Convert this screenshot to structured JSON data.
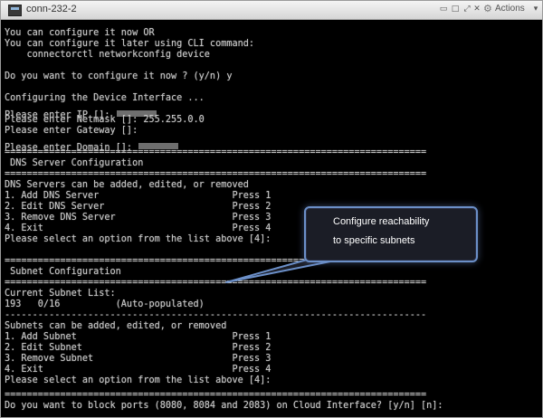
{
  "window": {
    "title": "conn-232-2",
    "actions_label": "Actions"
  },
  "terminal": {
    "lines": [
      "You can configure it now OR",
      "You can configure it later using CLI command:",
      "    connectorctl networkconfig device",
      "",
      "Do you want to configure it now ? (y/n) y",
      "",
      "Configuring the Device Interface ...",
      "Please enter IP []:",
      "Please enter Netmask []: 255.255.0.0",
      "Please enter Gateway []:",
      "Please enter Domain []:",
      "============================================================================",
      " DNS Server Configuration",
      "============================================================================",
      "DNS Servers can be added, edited, or removed",
      "1. Add DNS Server                        Press 1",
      "2. Edit DNS Server                       Press 2",
      "3. Remove DNS Server                     Press 3",
      "4. Exit                                  Press 4",
      "Please select an option from the list above [4]:",
      "",
      "============================================================================",
      " Subnet Configuration",
      "============================================================================",
      "Current Subnet List:",
      "193   0/16          (Auto-populated)",
      "----------------------------------------------------------------------------",
      "Subnets can be added, edited, or removed",
      "1. Add Subnet                            Press 1",
      "2. Edit Subnet                           Press 2",
      "3. Remove Subnet                         Press 3",
      "4. Exit                                  Press 4",
      "Please select an option from the list above [4]:",
      "",
      "",
      "============================================================================",
      "Do you want to block ports (8080, 8084 and 2083) on Cloud Interface? [y/n] [n]:"
    ]
  },
  "callout": {
    "line1": "Configure reachability",
    "line2": "to specific subnets"
  },
  "colors": {
    "terminal_bg": "#000000",
    "terminal_fg": "#c8c8c8",
    "callout_border": "#6b8fc8",
    "callout_bg": "#1b1d26"
  }
}
